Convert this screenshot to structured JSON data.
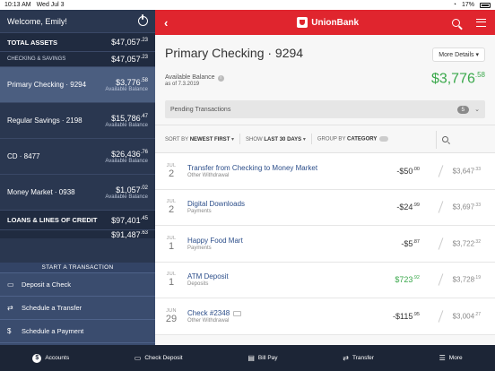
{
  "status_bar": {
    "time": "10:13 AM",
    "date": "Wed Jul 3",
    "battery_pct": "17%"
  },
  "sidebar": {
    "welcome": "Welcome, Emily!",
    "total_assets": {
      "label": "TOTAL ASSETS",
      "amount": "$47,057",
      "cents": ".23"
    },
    "checking_savings": {
      "label": "CHECKING & SAVINGS",
      "amount": "$47,057",
      "cents": ".23"
    },
    "accounts": [
      {
        "name": "Primary Checking · 9294",
        "amount": "$3,776",
        "cents": ".58",
        "sub": "Available Balance",
        "selected": true
      },
      {
        "name": "Regular Savings · 2198",
        "amount": "$15,786",
        "cents": ".47",
        "sub": "Available Balance"
      },
      {
        "name": "CD · 8477",
        "amount": "$26,436",
        "cents": ".76",
        "sub": "Available Balance"
      },
      {
        "name": "Money Market · 0938",
        "amount": "$1,057",
        "cents": ".02",
        "sub": "Available Balance"
      }
    ],
    "loans": {
      "label": "LOANS & LINES OF CREDIT",
      "amount": "$97,401",
      "cents": ".45"
    },
    "cut_row": {
      "amount": "$91,487",
      "cents": ".63"
    },
    "start_transaction": "START A TRANSACTION",
    "actions": [
      {
        "label": "Deposit a Check",
        "icon": "card-icon"
      },
      {
        "label": "Schedule a Transfer",
        "icon": "transfer-icon"
      },
      {
        "label": "Schedule a Payment",
        "icon": "dollar-icon"
      }
    ]
  },
  "topbar": {
    "brand": "UnionBank",
    "accent": "#e0252e"
  },
  "account": {
    "title": "Primary Checking · 9294",
    "more_details": "More Details ▾",
    "available_label": "Available Balance",
    "as_of": "as of 7.3.2019",
    "available_amount": "$3,776",
    "available_cents": ".58",
    "pending_label": "Pending Transactions",
    "pending_count": "5"
  },
  "sort": {
    "sort_by_label": "SORT BY",
    "sort_by_value": "NEWEST FIRST",
    "show_label": "SHOW",
    "show_value": "LAST 30 DAYS",
    "group_label": "GROUP BY",
    "group_value": "CATEGORY"
  },
  "transactions": [
    {
      "month": "JUL",
      "day": "2",
      "name": "Transfer from Checking to Money Market",
      "category": "Other Withdrawal",
      "amount": "-$50",
      "cents": ".00",
      "positive": false,
      "balance": "$3,647",
      "bal_cents": ".33"
    },
    {
      "month": "JUL",
      "day": "2",
      "name": "Digital Downloads",
      "category": "Payments",
      "amount": "-$24",
      "cents": ".99",
      "positive": false,
      "balance": "$3,697",
      "bal_cents": ".33"
    },
    {
      "month": "JUL",
      "day": "1",
      "name": "Happy Food Mart",
      "category": "Payments",
      "amount": "-$5",
      "cents": ".87",
      "positive": false,
      "balance": "$3,722",
      "bal_cents": ".32"
    },
    {
      "month": "JUL",
      "day": "1",
      "name": "ATM Deposit",
      "category": "Deposits",
      "amount": "$723",
      "cents": ".92",
      "positive": true,
      "balance": "$3,728",
      "bal_cents": ".19"
    },
    {
      "month": "JUN",
      "day": "29",
      "name": "Check #2348",
      "category": "Other Withdrawal",
      "amount": "-$115",
      "cents": ".95",
      "positive": false,
      "balance": "$3,004",
      "bal_cents": ".27"
    }
  ],
  "tabbar": [
    {
      "label": "Accounts",
      "icon": "dollar-coin-icon"
    },
    {
      "label": "Check Deposit",
      "icon": "check-deposit-icon"
    },
    {
      "label": "Bill Pay",
      "icon": "bill-icon"
    },
    {
      "label": "Transfer",
      "icon": "transfer-icon"
    },
    {
      "label": "More",
      "icon": "more-icon"
    }
  ]
}
